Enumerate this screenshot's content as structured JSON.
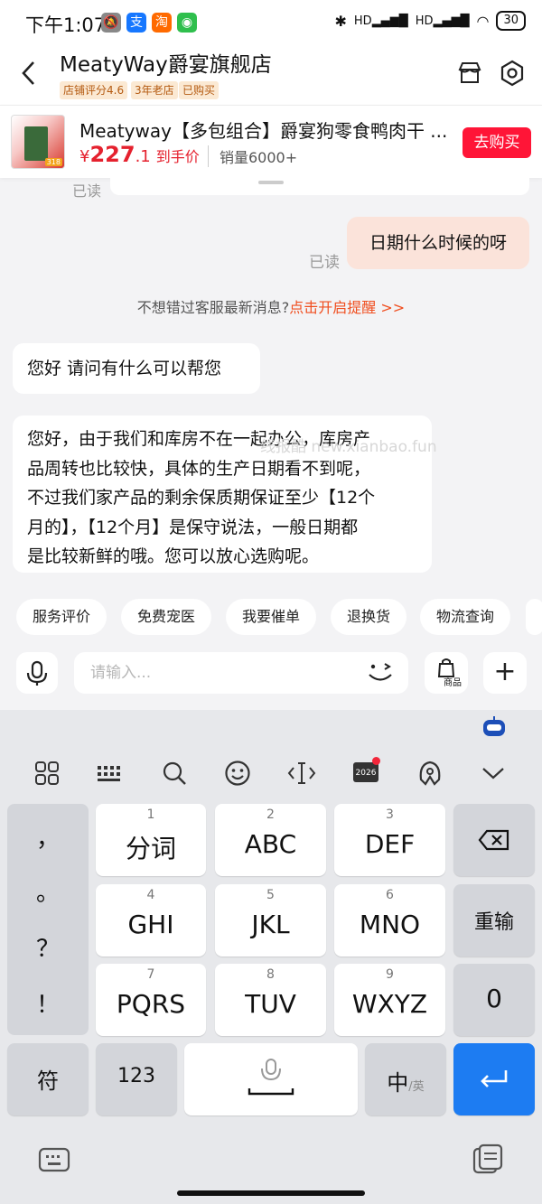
{
  "status": {
    "time": "下午1:07",
    "battery": "30",
    "signal": "HD"
  },
  "header": {
    "back_icon": "chevron-left-icon",
    "shop_name": "MeatyWay爵宴旗舰店",
    "tags": [
      "店铺评分4.6",
      "3年老店",
      "已购买"
    ],
    "store_icon": "store-icon",
    "settings_icon": "gear-icon"
  },
  "product": {
    "title": "Meatyway【多包组合】爵宴狗零食鸭肉干 ...",
    "price_symbol": "¥",
    "price_int": "227",
    "price_dec": ".1",
    "price_suffix": "到手价",
    "sales": "销量6000+",
    "buy_label": "去购买",
    "thumb_badge": "318"
  },
  "chat": {
    "read_label_1": "已读",
    "read_label_2": "已读",
    "my_message": "日期什么时候的呀",
    "notice_prefix": "不想错过客服最新消息?",
    "notice_link": "点击开启提醒 >>",
    "msg1": "您好 请问有什么可以帮您",
    "msg2_lines": [
      "您好，由于我们和库房不在一起办公，库房产",
      "品周转也比较快，具体的生产日期看不到呢，",
      "不过我们家产品的剩余保质期保证至少【12个",
      "月的】，【12个月】是保守说法，一般日期都",
      "是比较新鲜的哦。您可以放心选购呢。"
    ],
    "watermark": "线报酷 new.xianbao.fun"
  },
  "chips": [
    "服务评价",
    "免费宠医",
    "我要催单",
    "退换货",
    "物流查询"
  ],
  "input": {
    "placeholder": "请输入...",
    "goods_label": "商品",
    "plus": "+"
  },
  "keyboard": {
    "toolbar": [
      "apps-icon",
      "keyboard-icon",
      "search-icon",
      "emoji-icon",
      "cursor-icon",
      "calendar-2026-icon",
      "skin-icon",
      "collapse-icon"
    ],
    "calendar_year": "2026",
    "punct": [
      "，",
      "。",
      "？",
      "！"
    ],
    "keys": [
      {
        "num": "1",
        "label": "分词"
      },
      {
        "num": "2",
        "label": "ABC"
      },
      {
        "num": "3",
        "label": "DEF"
      },
      {
        "num": "4",
        "label": "GHI"
      },
      {
        "num": "5",
        "label": "JKL"
      },
      {
        "num": "6",
        "label": "MNO"
      },
      {
        "num": "7",
        "label": "PQRS"
      },
      {
        "num": "8",
        "label": "TUV"
      },
      {
        "num": "9",
        "label": "WXYZ"
      }
    ],
    "delete_icon": "backspace-icon",
    "reinput": "重输",
    "zero": "0",
    "symbols": "符",
    "numbers": "123",
    "lang_cn": "中",
    "lang_sep": "/英",
    "enter_icon": "enter-icon"
  },
  "colors": {
    "accent_red": "#ff1537",
    "price_red": "#e5212e",
    "my_bubble": "#fbe3da",
    "enter_blue": "#1d7cf2",
    "notice_orange": "#f04e1f"
  }
}
